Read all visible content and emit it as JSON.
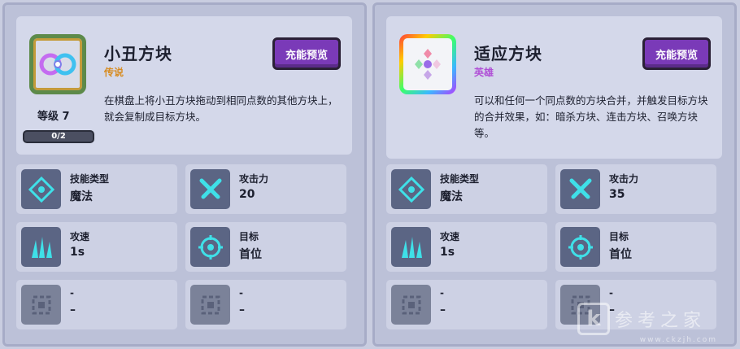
{
  "cards": [
    {
      "name": "小丑方块",
      "rarity": "传说",
      "preview_label": "充能预览",
      "description": "在棋盘上将小丑方块拖动到相同点数的其他方块上，就会复制成目标方块。",
      "level": "等级 7",
      "progress": "0/2",
      "progress_fraction": 0,
      "stats": [
        {
          "label": "技能类型",
          "value": "魔法",
          "icon": "diamond-target-icon"
        },
        {
          "label": "攻击力",
          "value": "20",
          "icon": "crossed-swords-icon"
        },
        {
          "label": "攻速",
          "value": "1s",
          "icon": "claw-spikes-icon"
        },
        {
          "label": "目标",
          "value": "首位",
          "icon": "crosshair-icon"
        },
        {
          "label": "-",
          "value": "–",
          "icon": "empty-slot-icon"
        },
        {
          "label": "-",
          "value": "–",
          "icon": "empty-slot-icon"
        }
      ]
    },
    {
      "name": "适应方块",
      "rarity": "英雄",
      "preview_label": "充能预览",
      "description": "可以和任何一个同点数的方块合并，并触发目标方块的合并效果，如：暗杀方块、连击方块、召唤方块等。",
      "stats": [
        {
          "label": "技能类型",
          "value": "魔法",
          "icon": "diamond-target-icon"
        },
        {
          "label": "攻击力",
          "value": "35",
          "icon": "crossed-swords-icon"
        },
        {
          "label": "攻速",
          "value": "1s",
          "icon": "claw-spikes-icon"
        },
        {
          "label": "目标",
          "value": "首位",
          "icon": "crosshair-icon"
        },
        {
          "label": "-",
          "value": "–",
          "icon": "empty-slot-icon"
        },
        {
          "label": "-",
          "value": "–",
          "icon": "empty-slot-icon"
        }
      ]
    }
  ],
  "watermark": {
    "letter": "k",
    "text": "参考之家",
    "url": "www.ckzjh.com"
  },
  "colors": {
    "cyan_accent": "#3fe0e8",
    "preview_button": "#7a3ab8",
    "legend_rarity": "#d78b1f",
    "hero_rarity": "#b04fd6"
  }
}
